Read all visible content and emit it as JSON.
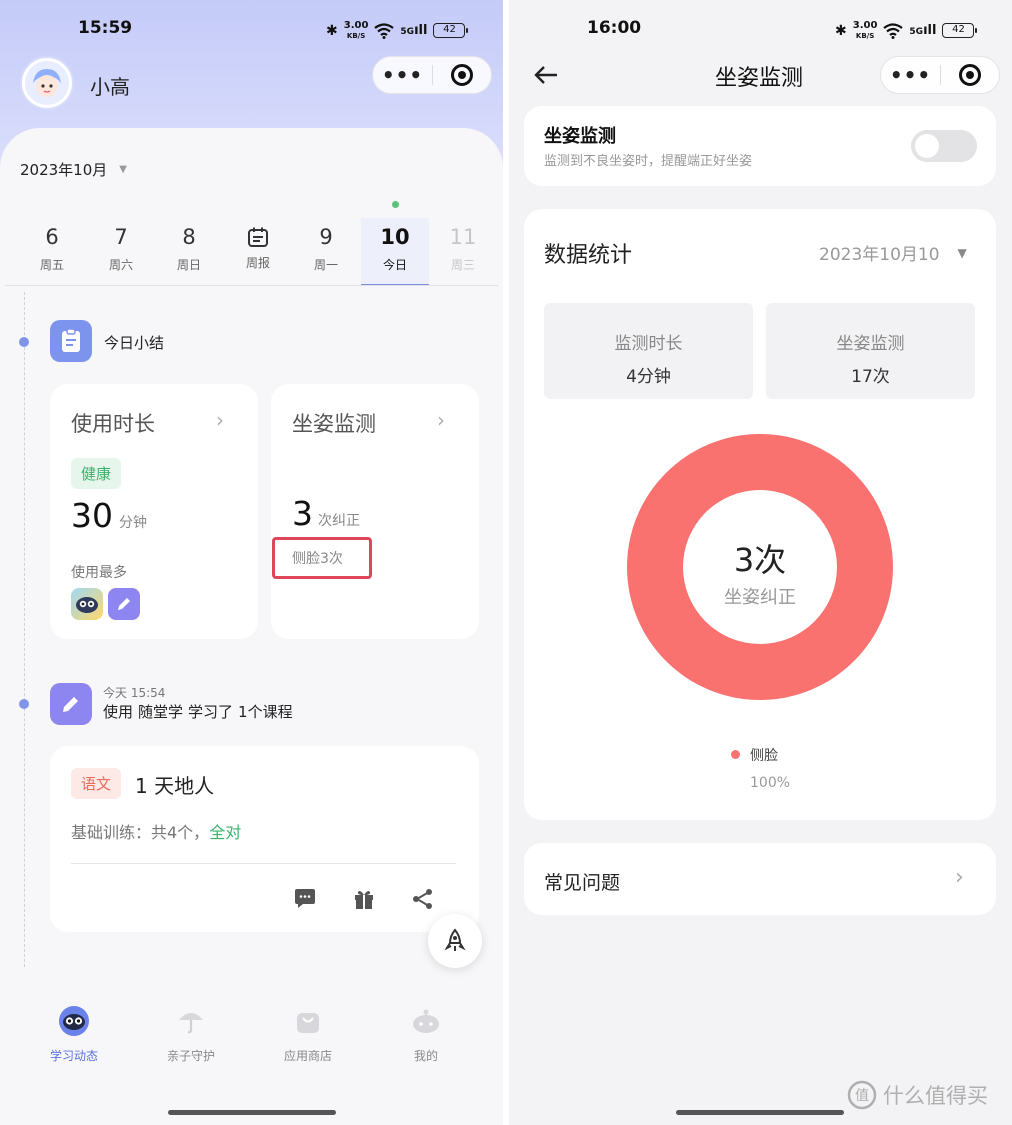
{
  "left": {
    "status": {
      "time": "15:59",
      "speed": "3.00",
      "speed_unit": "KB/S",
      "net": "5G",
      "battery": "42"
    },
    "user": {
      "name": "小高"
    },
    "month": "2023年10月",
    "days": [
      {
        "num": "6",
        "label": "周五"
      },
      {
        "num": "7",
        "label": "周六"
      },
      {
        "num": "8",
        "label": "周日"
      },
      {
        "num": "",
        "label": "周报",
        "icon": "calendar-icon"
      },
      {
        "num": "9",
        "label": "周一"
      },
      {
        "num": "10",
        "label": "今日"
      },
      {
        "num": "11",
        "label": "周三"
      }
    ],
    "summary": {
      "title": "今日小结"
    },
    "usage_card": {
      "title": "使用时长",
      "tag": "健康",
      "value": "30",
      "unit": "分钟",
      "most_used_label": "使用最多"
    },
    "posture_card": {
      "title": "坐姿监测",
      "value": "3",
      "unit": "次纠正",
      "detail": "侧脸3次"
    },
    "activity": {
      "time": "今天 15:54",
      "prefix": "使用",
      "app": "随堂学",
      "suffix": "学习了",
      "count": "1个课程"
    },
    "lesson_card": {
      "subject": "语文",
      "title": "1 天地人",
      "summary_prefix": "基础训练：共4个，",
      "summary_result": "全对"
    },
    "nav": [
      {
        "label": "学习动态",
        "icon": "owl-icon"
      },
      {
        "label": "亲子守护",
        "icon": "umbrella-icon"
      },
      {
        "label": "应用商店",
        "icon": "shopping-bag-icon"
      },
      {
        "label": "我的",
        "icon": "robot-icon"
      }
    ]
  },
  "right": {
    "status": {
      "time": "16:00",
      "speed": "3.00",
      "speed_unit": "KB/S",
      "net": "5G",
      "battery": "42"
    },
    "page_title": "坐姿监测",
    "setting": {
      "title": "坐姿监测",
      "desc": "监测到不良坐姿时，提醒端正好坐姿",
      "enabled": false
    },
    "stats": {
      "title": "数据统计",
      "date": "2023年10月10",
      "duration_label": "监测时长",
      "duration_value": "4分钟",
      "posture_label": "坐姿监测",
      "posture_value": "17次"
    },
    "faq": {
      "label": "常见问题"
    }
  },
  "chart_data": {
    "type": "pie",
    "center_value": "3次",
    "center_label": "坐姿纠正",
    "slices": [
      {
        "name": "侧脸",
        "value": 100,
        "label": "100%"
      }
    ],
    "colors": [
      "#f97270"
    ]
  },
  "watermark": {
    "text": "什么值得买"
  },
  "colors": {
    "accent": "#7b8fe8",
    "posture_red": "#f97270",
    "healthy_green": "#3bb36a",
    "highlight": "#e0465a"
  }
}
